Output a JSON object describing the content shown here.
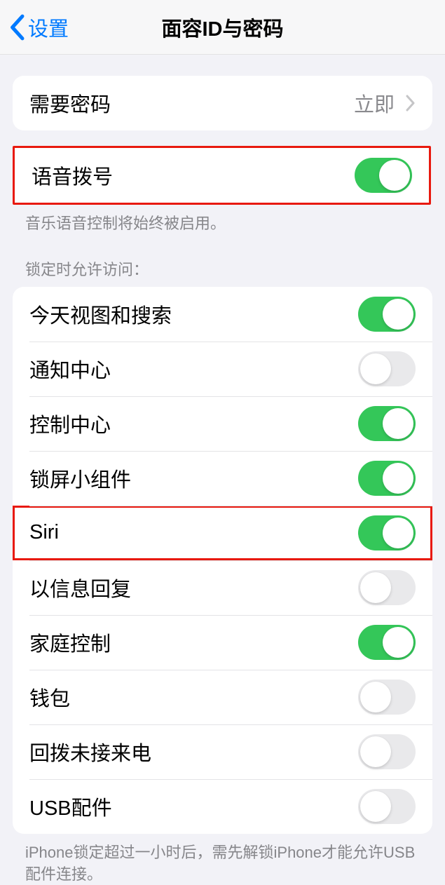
{
  "nav": {
    "back_label": "设置",
    "title": "面容ID与密码"
  },
  "require_passcode": {
    "label": "需要密码",
    "value": "立即"
  },
  "voice_dial": {
    "label": "语音拨号",
    "enabled": true,
    "footer": "音乐语音控制将始终被启用。"
  },
  "locked_access": {
    "header": "锁定时允许访问：",
    "items": [
      {
        "label": "今天视图和搜索",
        "enabled": true
      },
      {
        "label": "通知中心",
        "enabled": false
      },
      {
        "label": "控制中心",
        "enabled": true
      },
      {
        "label": "锁屏小组件",
        "enabled": true
      },
      {
        "label": "Siri",
        "enabled": true,
        "highlighted": true
      },
      {
        "label": "以信息回复",
        "enabled": false
      },
      {
        "label": "家庭控制",
        "enabled": true
      },
      {
        "label": "钱包",
        "enabled": false
      },
      {
        "label": "回拨未接来电",
        "enabled": false
      },
      {
        "label": "USB配件",
        "enabled": false
      }
    ],
    "footer": "iPhone锁定超过一小时后，需先解锁iPhone才能允许USB配件连接。"
  }
}
